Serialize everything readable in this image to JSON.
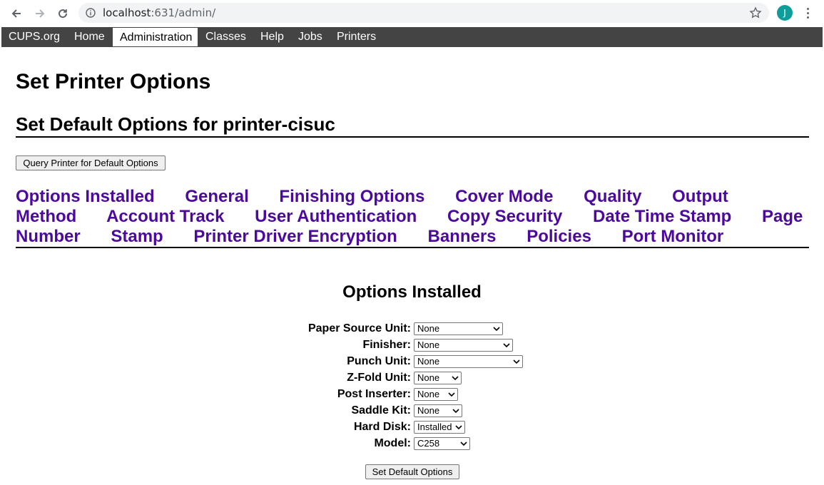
{
  "browser": {
    "url_host": "localhost",
    "url_path": ":631/admin/",
    "avatar_letter": "J"
  },
  "nav": {
    "items": [
      "CUPS.org",
      "Home",
      "Administration",
      "Classes",
      "Help",
      "Jobs",
      "Printers"
    ],
    "active": "Administration"
  },
  "page": {
    "title": "Set Printer Options",
    "subtitle": "Set Default Options for printer-cisuc",
    "query_button": "Query Printer for Default Options",
    "tabs": [
      "Options Installed",
      "General",
      "Finishing Options",
      "Cover Mode",
      "Quality",
      "Output Method",
      "Account Track",
      "User Authentication",
      "Copy Security",
      "Date Time Stamp",
      "Page Number",
      "Stamp",
      "Printer Driver Encryption",
      "Banners",
      "Policies",
      "Port Monitor"
    ],
    "section_title": "Options Installed",
    "options": [
      {
        "label": "Paper Source Unit:",
        "value": "None"
      },
      {
        "label": "Finisher:",
        "value": "None"
      },
      {
        "label": "Punch Unit:",
        "value": "None"
      },
      {
        "label": "Z-Fold Unit:",
        "value": "None"
      },
      {
        "label": "Post Inserter:",
        "value": "None"
      },
      {
        "label": "Saddle Kit:",
        "value": "None"
      },
      {
        "label": "Hard Disk:",
        "value": "Installed"
      },
      {
        "label": "Model:",
        "value": "C258"
      }
    ],
    "submit_button": "Set Default Options"
  },
  "colors": {
    "nav_bg": "#444444",
    "link": "#4b0a9c",
    "avatar": "#0f9d9a"
  }
}
